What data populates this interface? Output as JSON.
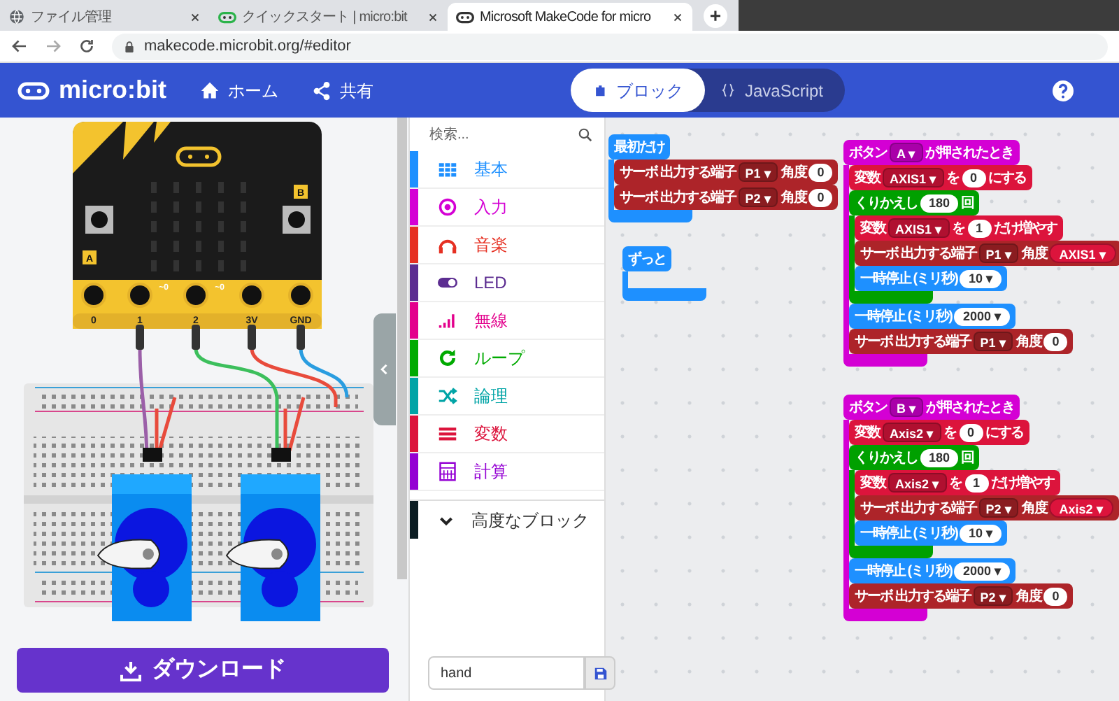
{
  "browser": {
    "tabs": [
      {
        "title": "ファイル管理",
        "selected": false
      },
      {
        "title": "クイックスタート | micro:bit",
        "selected": false
      },
      {
        "title": "Microsoft MakeCode for micro",
        "selected": true
      }
    ],
    "new_tab": "+",
    "address": "makecode.microbit.org/#editor"
  },
  "header": {
    "logo": "micro:bit",
    "nav": [
      {
        "label": "ホーム",
        "kind": "home"
      },
      {
        "label": "共有",
        "kind": "share"
      }
    ],
    "editor_toggle": [
      {
        "label": "ブロック",
        "selected": true,
        "kind": "blocks"
      },
      {
        "label": "JavaScript",
        "selected": false,
        "kind": "js"
      }
    ]
  },
  "simulator": {
    "pins": [
      "0",
      "1",
      "2",
      "3V",
      "GND"
    ],
    "analog_marks": [
      "~0",
      "~0"
    ],
    "buttons": [
      "A",
      "B"
    ],
    "download": "ダウンロード"
  },
  "toolbox": {
    "search": {
      "placeholder": "検索..."
    },
    "categories": [
      {
        "label": "基本",
        "color": "#1e90ff",
        "kind": "basic"
      },
      {
        "label": "入力",
        "color": "#d400d4",
        "kind": "input"
      },
      {
        "label": "音楽",
        "color": "#e63022",
        "kind": "music"
      },
      {
        "label": "LED",
        "color": "#5c2d91",
        "kind": "led"
      },
      {
        "label": "無線",
        "color": "#e3008c",
        "kind": "radio"
      },
      {
        "label": "ループ",
        "color": "#00aa00",
        "kind": "loops"
      },
      {
        "label": "論理",
        "color": "#00a4a6",
        "kind": "logic"
      },
      {
        "label": "変数",
        "color": "#dc143c",
        "kind": "variables"
      },
      {
        "label": "計算",
        "color": "#9400d3",
        "kind": "math"
      }
    ],
    "advanced": {
      "label": "高度なブロック",
      "expanded": false
    }
  },
  "scripts": [
    {
      "kind": "on_start",
      "tokens": [
        {
          "kind": "text",
          "text": "最初だけ"
        }
      ],
      "children": [
        {
          "kind": "servo",
          "tokens": [
            {
              "kind": "text",
              "text": "サーボ 出力する端子"
            },
            {
              "kind": "dropdown",
              "text": "P1 ▾"
            },
            {
              "kind": "text",
              "text": "角度"
            },
            {
              "kind": "number",
              "text": "0"
            }
          ]
        },
        {
          "kind": "servo",
          "tokens": [
            {
              "kind": "text",
              "text": "サーボ 出力する端子"
            },
            {
              "kind": "dropdown",
              "text": "P2 ▾"
            },
            {
              "kind": "text",
              "text": "角度"
            },
            {
              "kind": "number",
              "text": "0"
            }
          ]
        }
      ]
    },
    {
      "kind": "forever",
      "tokens": [
        {
          "kind": "text",
          "text": "ずっと"
        }
      ]
    },
    {
      "kind": "event",
      "tokens": [
        {
          "kind": "text",
          "text": "ボタン"
        },
        {
          "kind": "dropdown",
          "text": "A ▾"
        },
        {
          "kind": "text",
          "text": "が押されたとき"
        }
      ],
      "children": [
        {
          "kind": "variable",
          "tokens": [
            {
              "kind": "text",
              "text": "変数"
            },
            {
              "kind": "dropdown",
              "text": "AXIS1 ▾"
            },
            {
              "kind": "text",
              "text": "を"
            },
            {
              "kind": "number",
              "text": "0"
            },
            {
              "kind": "text",
              "text": "にする"
            }
          ]
        },
        {
          "kind": "loop",
          "tokens": [
            {
              "kind": "text",
              "text": "くりかえし"
            },
            {
              "kind": "number",
              "text": "180"
            },
            {
              "kind": "text",
              "text": "回"
            }
          ],
          "children": [
            {
              "kind": "variable",
              "tokens": [
                {
                  "kind": "text",
                  "text": "変数"
                },
                {
                  "kind": "dropdown",
                  "text": "AXIS1 ▾"
                },
                {
                  "kind": "text",
                  "text": "を"
                },
                {
                  "kind": "number",
                  "text": "1"
                },
                {
                  "kind": "text",
                  "text": "だけ増やす"
                }
              ]
            },
            {
              "kind": "servo",
              "tokens": [
                {
                  "kind": "text",
                  "text": "サーボ 出力する端子"
                },
                {
                  "kind": "dropdown",
                  "text": "P1 ▾"
                },
                {
                  "kind": "text",
                  "text": "角度"
                },
                {
                  "kind": "variable",
                  "text": "AXIS1 ▾"
                }
              ]
            },
            {
              "kind": "pause",
              "tokens": [
                {
                  "kind": "text",
                  "text": "一時停止 (ミリ秒)"
                },
                {
                  "kind": "number",
                  "text": "10 ▾"
                }
              ]
            }
          ]
        },
        {
          "kind": "pause",
          "tokens": [
            {
              "kind": "text",
              "text": "一時停止 (ミリ秒)"
            },
            {
              "kind": "number",
              "text": "2000 ▾"
            }
          ]
        },
        {
          "kind": "servo",
          "tokens": [
            {
              "kind": "text",
              "text": "サーボ 出力する端子"
            },
            {
              "kind": "dropdown",
              "text": "P1 ▾"
            },
            {
              "kind": "text",
              "text": "角度"
            },
            {
              "kind": "number",
              "text": "0"
            }
          ]
        }
      ]
    },
    {
      "kind": "event",
      "tokens": [
        {
          "kind": "text",
          "text": "ボタン"
        },
        {
          "kind": "dropdown",
          "text": "B ▾"
        },
        {
          "kind": "text",
          "text": "が押されたとき"
        }
      ],
      "children": [
        {
          "kind": "variable",
          "tokens": [
            {
              "kind": "text",
              "text": "変数"
            },
            {
              "kind": "dropdown",
              "text": "Axis2 ▾"
            },
            {
              "kind": "text",
              "text": "を"
            },
            {
              "kind": "number",
              "text": "0"
            },
            {
              "kind": "text",
              "text": "にする"
            }
          ]
        },
        {
          "kind": "loop",
          "tokens": [
            {
              "kind": "text",
              "text": "くりかえし"
            },
            {
              "kind": "number",
              "text": "180"
            },
            {
              "kind": "text",
              "text": "回"
            }
          ],
          "children": [
            {
              "kind": "variable",
              "tokens": [
                {
                  "kind": "text",
                  "text": "変数"
                },
                {
                  "kind": "dropdown",
                  "text": "Axis2 ▾"
                },
                {
                  "kind": "text",
                  "text": "を"
                },
                {
                  "kind": "number",
                  "text": "1"
                },
                {
                  "kind": "text",
                  "text": "だけ増やす"
                }
              ]
            },
            {
              "kind": "servo",
              "tokens": [
                {
                  "kind": "text",
                  "text": "サーボ 出力する端子"
                },
                {
                  "kind": "dropdown",
                  "text": "P2 ▾"
                },
                {
                  "kind": "text",
                  "text": "角度"
                },
                {
                  "kind": "variable",
                  "text": "Axis2 ▾"
                }
              ]
            },
            {
              "kind": "pause",
              "tokens": [
                {
                  "kind": "text",
                  "text": "一時停止 (ミリ秒)"
                },
                {
                  "kind": "number",
                  "text": "10 ▾"
                }
              ]
            }
          ]
        },
        {
          "kind": "pause",
          "tokens": [
            {
              "kind": "text",
              "text": "一時停止 (ミリ秒)"
            },
            {
              "kind": "number",
              "text": "2000 ▾"
            }
          ]
        },
        {
          "kind": "servo",
          "tokens": [
            {
              "kind": "text",
              "text": "サーボ 出力する端子"
            },
            {
              "kind": "dropdown",
              "text": "P2 ▾"
            },
            {
              "kind": "text",
              "text": "角度"
            },
            {
              "kind": "number",
              "text": "0"
            }
          ]
        }
      ]
    }
  ],
  "project": {
    "name": "hand"
  }
}
